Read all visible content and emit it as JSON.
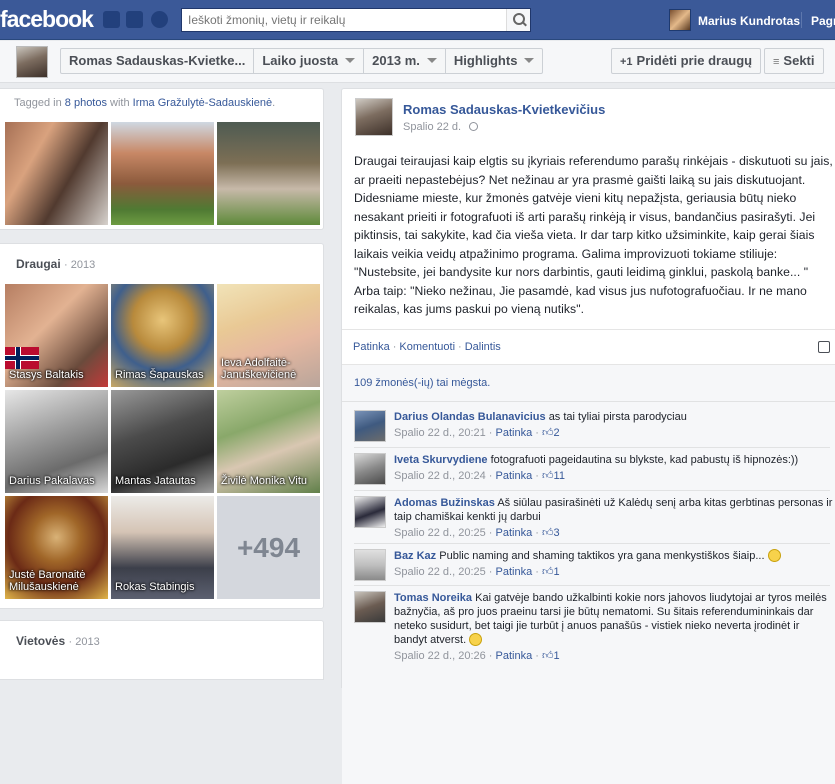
{
  "topbar": {
    "logo": "facebook",
    "search_placeholder": "Ieškoti žmonių, vietų ir reikalų",
    "user_name": "Marius Kundrotas",
    "home_label": "Pagrin"
  },
  "subnav": {
    "profile_name": "Romas Sadauskas-Kvietke...",
    "timeline_label": "Laiko juosta",
    "year_label": "2013 m.",
    "highlights_label": "Highlights",
    "add_friend_label": "Pridėti prie draugų",
    "follow_label": "Sekti"
  },
  "tagged": {
    "prefix": "Tagged in",
    "photos_link": "8 photos",
    "with": "with",
    "person": "Irma Gražulytė-Sadauskienė",
    "suffix": "."
  },
  "friends": {
    "title": "Draugai",
    "year": "· 2013",
    "items": [
      {
        "name": "Stasys Baltakis"
      },
      {
        "name": "Rimas Šapauskas"
      },
      {
        "name": "Ieva Adolfaitė-Januškevičienė"
      },
      {
        "name": "Darius Pakalavas"
      },
      {
        "name": "Mantas Jatautas"
      },
      {
        "name": "Živilė Monika Vitu"
      },
      {
        "name": "Justė Baronaitė Milušauskienė"
      },
      {
        "name": "Rokas Stabingis"
      }
    ],
    "more": "+494"
  },
  "places": {
    "title": "Vietovės",
    "year": "· 2013"
  },
  "post": {
    "author": "Romas Sadauskas-Kvietkevičius",
    "date": "Spalio 22 d.",
    "text": "Draugai teiraujasi kaip elgtis su įkyriais referendumo parašų rinkėjais - diskutuoti su jais, ar praeiti nepastebėjus? Net nežinau ar yra prasmė gaišti laiką su jais diskutuojant. Didesniame mieste, kur žmonės gatvėje vieni kitų nepažįsta, geriausia būtų nieko nesakant prieiti ir fotografuoti iš arti parašų rinkėją ir visus, bandančius pasirašyti. Jei piktinsis, tai sakykite, kad čia vieša vieta. Ir dar tarp kitko užsiminkite, kaip gerai šiais laikais veikia veidų atpažinimo programa. Galima improvizuoti tokiame stiliuje: \"Nustebsite, jei bandysite kur nors darbintis, gauti leidimą ginklui, paskolą banke... \" Arba taip: \"Nieko nežinau, Jie pasamdė, kad visus jus nufotografuočiau. Ir ne mano reikalas, kas jums paskui po vieną nutiks\".",
    "actions": {
      "like": "Patinka",
      "comment": "Komentuoti",
      "share": "Dalintis"
    },
    "likes": "109 žmonės(-ių) tai mėgsta."
  },
  "comments": [
    {
      "name": "Darius Olandas Bulanavicius",
      "text": "as tai tyliai pirsta parodyciau",
      "time": "Spalio 22 d., 20:21",
      "like": "Patinka",
      "count": "2",
      "smile": false
    },
    {
      "name": "Iveta Skurvydiene",
      "text": "fotografuoti pageidautina su blykste, kad pabustų iš hipnozės:))",
      "time": "Spalio 22 d., 20:24",
      "like": "Patinka",
      "count": "11",
      "smile": false
    },
    {
      "name": "Adomas Bužinskas",
      "text": "Aš siūlau pasirašinėti už Kalėdų senį arba kitas gerbtinas personas ir taip chamiškai kenkti jų darbui",
      "time": "Spalio 22 d., 20:25",
      "like": "Patinka",
      "count": "3",
      "smile": false
    },
    {
      "name": "Baz Kaz",
      "text": "Public naming and shaming taktikos yra gana menkystiškos šiaip...",
      "time": "Spalio 22 d., 20:25",
      "like": "Patinka",
      "count": "1",
      "smile": true
    },
    {
      "name": "Tomas Noreika",
      "text": "Kai gatvėje bando užkalbinti kokie nors jahovos liudytojai ar tyros meilės bažnyčia, aš pro juos praeinu tarsi jie būtų nematomi. Su šitais referenduminin­kais dar neteko susidurt, bet taigi jie turbūt į anuos panašūs - vistiek nieko neverta įrodinėt ir bandyt atverst.",
      "time": "Spalio 22 d., 20:26",
      "like": "Patinka",
      "count": "1",
      "smile": true
    }
  ],
  "colors": {
    "brand": "#3b5998",
    "link": "#365899"
  }
}
